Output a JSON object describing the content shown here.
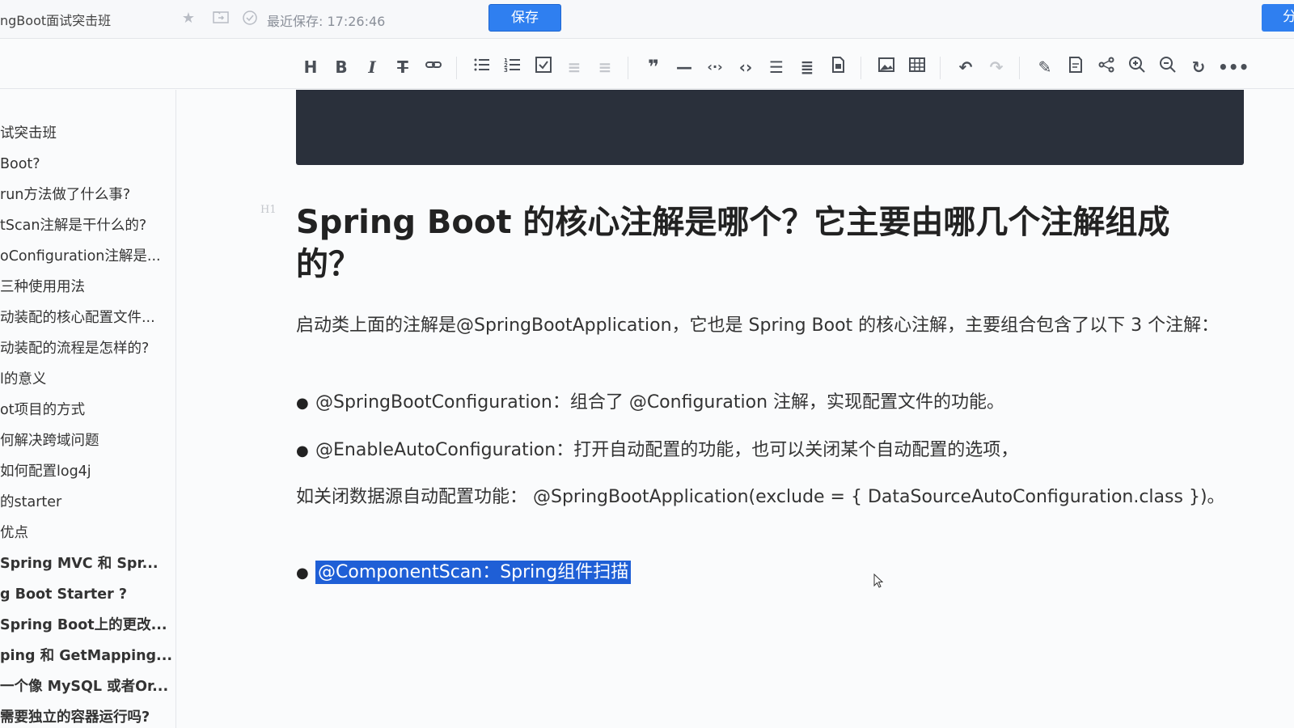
{
  "topbar": {
    "doc_title": "ngBoot面试突击班",
    "save_status": "最近保存: 17:26:46",
    "save_label": "保存",
    "share_label": "分"
  },
  "toolbar": {
    "tools": [
      "heading",
      "bold",
      "italic",
      "strikethrough",
      "link",
      "bullet-list",
      "ordered-list",
      "task-list",
      "indent",
      "outdent",
      "quote",
      "horizontal-rule",
      "inline-code",
      "code-block",
      "toc",
      "format",
      "attachment",
      "image",
      "table",
      "undo",
      "redo",
      "edit",
      "preview",
      "mindmap",
      "zoom-in",
      "zoom-out",
      "refresh",
      "more"
    ]
  },
  "sidebar": {
    "items": [
      {
        "label": "试突击班",
        "bold": false
      },
      {
        "label": "Boot?",
        "bold": false
      },
      {
        "label": "run方法做了什么事?",
        "bold": false
      },
      {
        "label": "tScan注解是干什么的?",
        "bold": false
      },
      {
        "label": "oConfiguration注解是...",
        "bold": false
      },
      {
        "label": "三种使用用法",
        "bold": false
      },
      {
        "label": "动装配的核心配置文件...",
        "bold": false
      },
      {
        "label": "动装配的流程是怎样的?",
        "bold": false
      },
      {
        "label": "l的意义",
        "bold": false
      },
      {
        "label": "ot项目的方式",
        "bold": false
      },
      {
        "label": "何解决跨域问题",
        "bold": false
      },
      {
        "label": "如何配置log4j",
        "bold": false
      },
      {
        "label": "的starter",
        "bold": false
      },
      {
        "label": "优点",
        "bold": false
      },
      {
        "label": "  Spring MVC 和 Spr...",
        "bold": true
      },
      {
        "label": "g Boot Starter ?",
        "bold": true
      },
      {
        "label": "Spring Boot上的更改...",
        "bold": true
      },
      {
        "label": "ping 和 GetMapping...",
        "bold": true
      },
      {
        "label": "一个像 MySQL 或者Or...",
        "bold": true
      },
      {
        "label": "需要独立的容器运行吗?",
        "bold": true
      }
    ]
  },
  "content": {
    "h1_marker": "H1",
    "heading": "Spring Boot 的核心注解是哪个？它主要由哪几个注解组成的？",
    "intro": "启动类上面的注解是@SpringBootApplication，它也是 Spring Boot 的核心注解，主要组合包含了以下 3 个注解：",
    "bullet1": "@SpringBootConfiguration：组合了 @Configuration 注解，实现配置文件的功能。",
    "bullet2": "@EnableAutoConfiguration：打开自动配置的功能，也可以关闭某个自动配置的选项，",
    "note": "如关闭数据源自动配置功能： @SpringBootApplication(exclude = { DataSourceAutoConfiguration.class })。",
    "bullet3": "@ComponentScan：Spring组件扫描"
  },
  "colors": {
    "accent": "#2f7ff0",
    "selection": "#1f5fd6",
    "codeblock_bg": "#2a303b"
  }
}
